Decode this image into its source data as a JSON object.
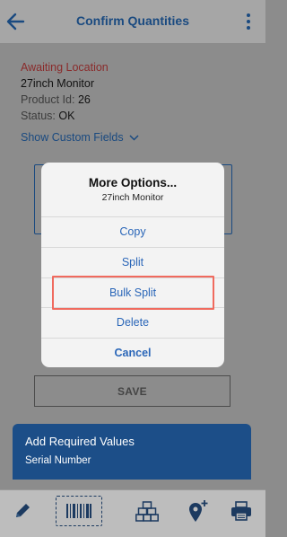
{
  "header": {
    "title": "Confirm Quantities",
    "back_icon": "arrow-left-icon",
    "menu_icon": "kebab-menu-icon"
  },
  "item": {
    "status_line": "Awaiting Location",
    "name": "27inch Monitor",
    "product_id_label": "Product Id:",
    "product_id_value": "26",
    "status_label": "Status:",
    "status_value": "OK",
    "custom_fields_link": "Show Custom Fields"
  },
  "modal": {
    "title": "More Options...",
    "subtitle": "27inch Monitor",
    "options": [
      {
        "label": "Copy"
      },
      {
        "label": "Split"
      },
      {
        "label": "Bulk Split"
      },
      {
        "label": "Delete"
      },
      {
        "label": "Cancel"
      }
    ],
    "highlighted_option": "Bulk Split"
  },
  "save_button": "SAVE",
  "toast": {
    "title": "Add Required Values",
    "message": "Serial Number"
  },
  "bottom_bar": {
    "icons": [
      "pencil-icon",
      "barcode-scan-icon",
      "boxes-stack-icon",
      "add-location-icon",
      "printer-icon"
    ]
  },
  "colors": {
    "accent": "#1a4a80",
    "option_text": "#2a66b8",
    "highlight": "#f06a5e",
    "toast_bg": "#1c4e88",
    "status_red": "#8a2b2b"
  }
}
